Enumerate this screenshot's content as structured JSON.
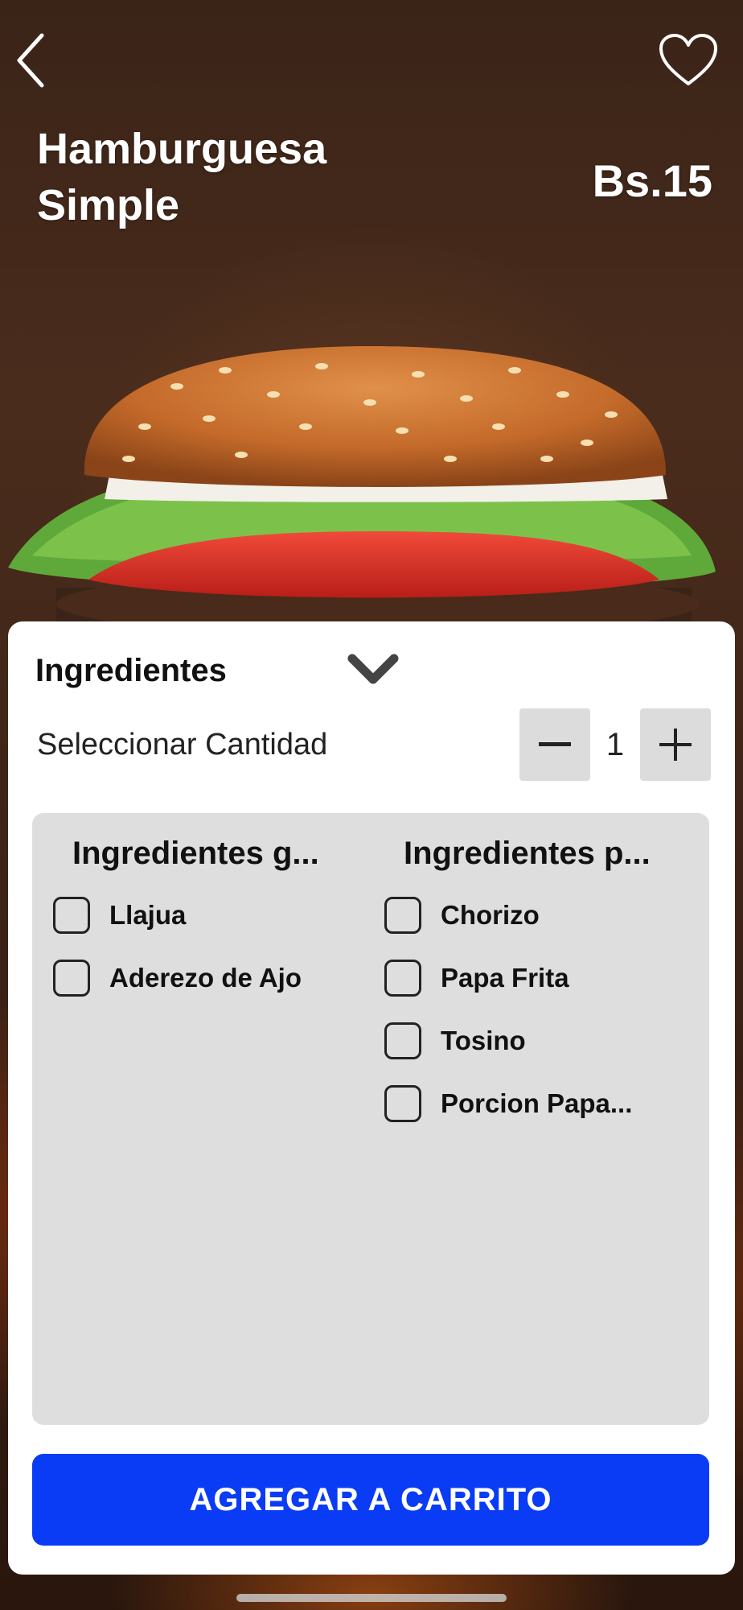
{
  "product": {
    "name": "Hamburguesa Simple",
    "price": "Bs.15"
  },
  "icons": {
    "back": "chevron-left-icon",
    "favorite": "heart-icon",
    "expand": "chevron-down-icon",
    "minus": "minus-icon",
    "plus": "plus-icon"
  },
  "sheet": {
    "section_title": "Ingredientes",
    "quantity_label": "Seleccionar Cantidad",
    "quantity_value": "1",
    "columns": [
      {
        "title": "Ingredientes g...",
        "options": [
          "Llajua",
          "Aderezo de Ajo"
        ]
      },
      {
        "title": "Ingredientes p...",
        "options": [
          "Chorizo",
          "Papa Frita",
          "Tosino",
          "Porcion Papa..."
        ]
      }
    ],
    "cta_label": "AGREGAR A CARRITO"
  },
  "colors": {
    "accent": "#0a3cf5",
    "panel": "#dedede",
    "stepper": "#dcdcdc"
  }
}
